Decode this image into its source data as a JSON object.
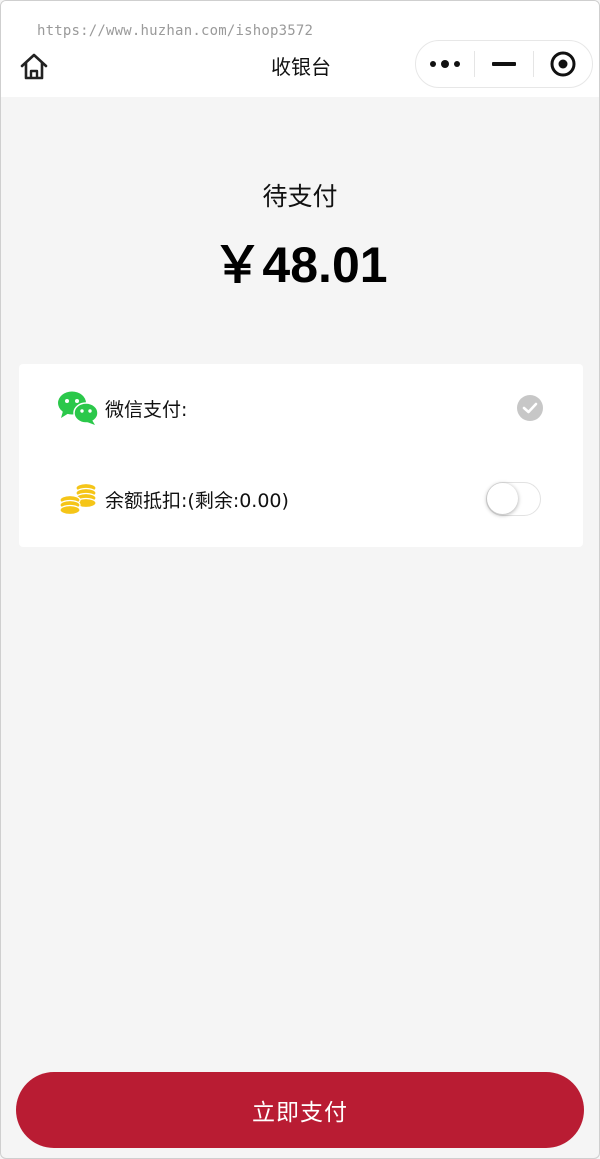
{
  "watermark": "https://www.huzhan.com/ishop3572",
  "nav": {
    "title": "收银台",
    "home_icon": "home-icon",
    "more_icon": "more-dots-icon",
    "minimize_icon": "minimize-icon",
    "close_icon": "target-close-icon"
  },
  "payment": {
    "status": "待支付",
    "amount": "￥48.01"
  },
  "methods": [
    {
      "icon": "wechat-icon",
      "label": "微信支付:",
      "control": "checked",
      "color": "#2bc84a"
    },
    {
      "icon": "coins-icon",
      "label": "余额抵扣:(剩余:0.00)",
      "control": "switch-off",
      "color": "#f5c518"
    }
  ],
  "submit_button": {
    "label": "立即支付",
    "color": "#b91c33"
  }
}
